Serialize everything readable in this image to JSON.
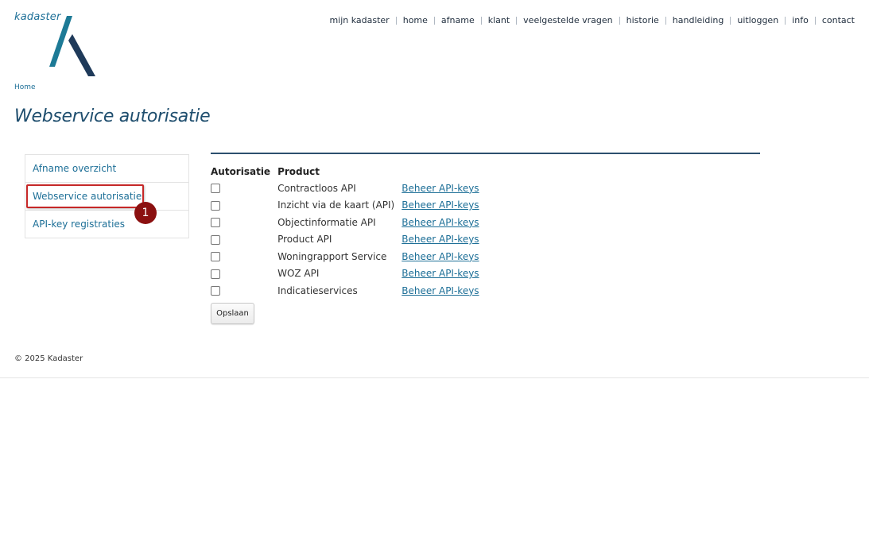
{
  "header": {
    "logo_text": "kadaster",
    "nav": [
      {
        "label": "mijn kadaster"
      },
      {
        "label": "home"
      },
      {
        "label": "afname"
      },
      {
        "label": "klant"
      },
      {
        "label": "veelgestelde vragen"
      },
      {
        "label": "historie"
      },
      {
        "label": "handleiding"
      },
      {
        "label": "uitloggen"
      },
      {
        "label": "info"
      },
      {
        "label": "contact"
      }
    ]
  },
  "breadcrumb": {
    "home": "Home"
  },
  "page_title": "Webservice autorisatie",
  "sidemenu": {
    "items": [
      {
        "label": "Afname overzicht"
      },
      {
        "label": "Webservice autorisatie"
      },
      {
        "label": "API-key registraties"
      }
    ]
  },
  "annotation": {
    "step": "1",
    "color": "#8b1010",
    "box_color": "#c62828"
  },
  "table": {
    "headers": {
      "authorization": "Autorisatie",
      "product": "Product"
    },
    "rows": [
      {
        "product": "Contractloos API",
        "link": "Beheer API-keys",
        "checked": false
      },
      {
        "product": "Inzicht via de kaart (API)",
        "link": "Beheer API-keys",
        "checked": false
      },
      {
        "product": "Objectinformatie API",
        "link": "Beheer API-keys",
        "checked": false
      },
      {
        "product": "Product API",
        "link": "Beheer API-keys",
        "checked": false
      },
      {
        "product": "Woningrapport Service",
        "link": "Beheer API-keys",
        "checked": false
      },
      {
        "product": "WOZ API",
        "link": "Beheer API-keys",
        "checked": false
      },
      {
        "product": "Indicatieservices",
        "link": "Beheer API-keys",
        "checked": false
      }
    ]
  },
  "save_label": "Opslaan",
  "footer": {
    "copyright": "© 2025 Kadaster"
  },
  "colors": {
    "brand_teal": "#1d6f97",
    "brand_navy": "#1f3a5a",
    "title": "#1f4e6e",
    "rule": "#2c4f6e"
  },
  "icons": {
    "logo": "kadaster-k-logo-icon",
    "checkbox": "checkbox-icon"
  }
}
